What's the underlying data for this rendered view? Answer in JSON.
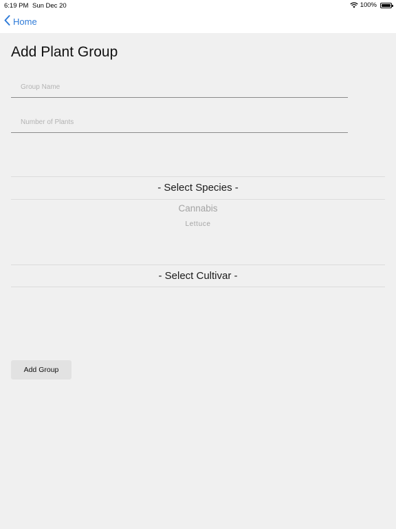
{
  "status_bar": {
    "time": "6:19 PM",
    "date": "Sun Dec 20",
    "battery": "100%"
  },
  "nav": {
    "back_label": "Home"
  },
  "page": {
    "title": "Add Plant Group"
  },
  "form": {
    "group_name_placeholder": "Group Name",
    "group_name_value": "",
    "num_plants_placeholder": "Number of Plants",
    "num_plants_value": ""
  },
  "species_picker": {
    "selected": "- Select Species -",
    "options": [
      "Cannabis",
      "Lettuce"
    ]
  },
  "cultivar_picker": {
    "selected": "- Select Cultivar -"
  },
  "actions": {
    "add_group_label": "Add Group"
  },
  "colors": {
    "accent": "#2f7bd8",
    "background": "#f0f0f0"
  }
}
